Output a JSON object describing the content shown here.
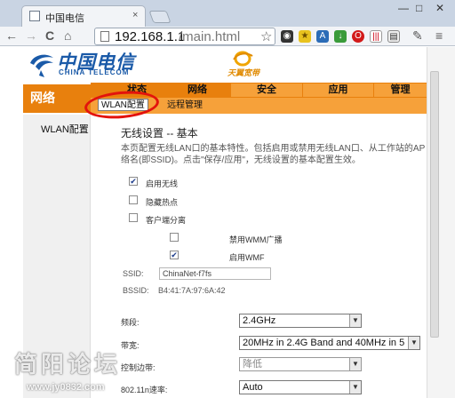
{
  "browser": {
    "tab_title": "中国电信",
    "tab_close": "×",
    "window_controls": [
      "—",
      "□",
      "✕"
    ],
    "nav_back": "←",
    "nav_forward": "→",
    "nav_reload": "C",
    "nav_home": "⌂",
    "url_host": "192.168.1.1",
    "url_path": "/main.html",
    "star": "☆",
    "menu": "≡",
    "extension_icons": [
      "camera-icon",
      "star-badge-icon",
      "translate-icon",
      "download-icon",
      "opera-icon",
      "stats-icon",
      "clipboard-icon"
    ]
  },
  "brand": {
    "name_cn": "中国电信",
    "name_en": "CHINA TELECOM",
    "sub_brand": "天翼宽带",
    "color": "#1a5aa8",
    "sub_color": "#e08a00"
  },
  "nav": {
    "section": "网络",
    "tabs": [
      {
        "label": "状态",
        "active": false
      },
      {
        "label": "网络",
        "active": true
      },
      {
        "label": "安全",
        "active": false
      },
      {
        "label": "应用",
        "active": false
      },
      {
        "label": "管理",
        "active": false
      }
    ],
    "subtabs": [
      {
        "label": "WLAN配置",
        "active": true
      },
      {
        "label": "远程管理",
        "active": false
      }
    ],
    "accent": "#e8800d"
  },
  "sidebar": {
    "items": [
      "WLAN配置"
    ]
  },
  "wlan": {
    "title": "无线设置 -- 基本",
    "desc_line1": "本页配置无线LAN口的基本特性。包括启用或禁用无线LAN口、从工作站的AP扫",
    "desc_line2": "络名(即SSID)。点击\"保存/应用\"，无线设置的基本配置生效。",
    "enable_wireless": {
      "label": "启用无线",
      "checked": true
    },
    "hide_ap": {
      "label": "隐藏热点",
      "checked": false
    },
    "client_isolation": {
      "label": "客户端分离",
      "checked": false
    },
    "disable_wmm": {
      "label": "禁用WMM广播",
      "checked": false
    },
    "enable_wmf": {
      "label": "启用WMF",
      "checked": true
    },
    "ssid_label": "SSID:",
    "ssid_value": "ChinaNet-f7fs",
    "bssid_label": "BSSID:",
    "bssid_value": "B4:41:7A:97:6A:42",
    "band_label": "频段:",
    "band_value": "2.4GHz",
    "bandwidth_label": "带宽:",
    "bandwidth_value": "20MHz in 2.4G Band and 40MHz in 5",
    "ctrl_sideband_label": "控制边带:",
    "ctrl_sideband_value": "降低",
    "rate_label": "802.11n速率:",
    "rate_value": "Auto"
  },
  "watermark": {
    "line1": "简阳论坛",
    "line2": "www.jy0832.com"
  }
}
